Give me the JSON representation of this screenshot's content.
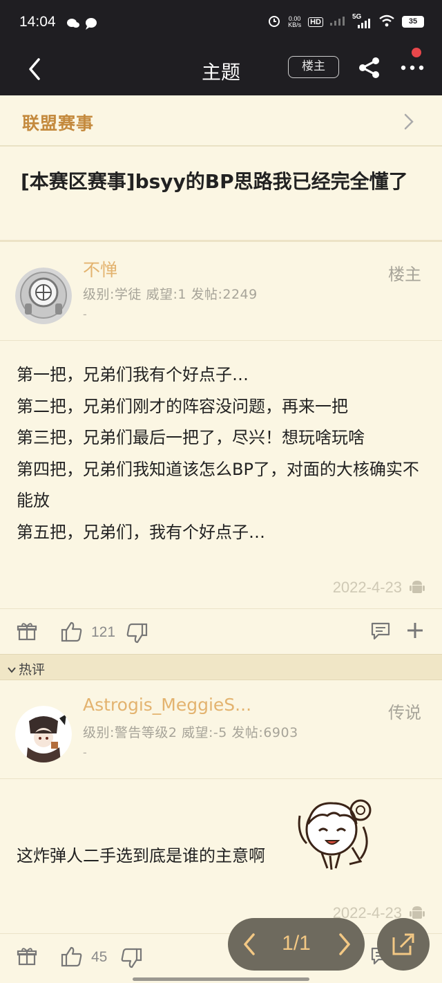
{
  "status_bar": {
    "time": "14:04",
    "net_speed_value": "0.00",
    "net_speed_unit": "KB/s",
    "hd": "HD",
    "network": "5G",
    "battery": "35"
  },
  "nav": {
    "title": "主题",
    "louzhu_button": "楼主"
  },
  "category": {
    "label": "联盟赛事"
  },
  "thread": {
    "title": "[本赛区赛事]bsyy的BP思路我已经完全懂了"
  },
  "main_post": {
    "username": "不惮",
    "meta": "级别:学徒 威望:1 发帖:2249",
    "dash": "-",
    "role": "楼主",
    "lines": [
      "第一把，兄弟们我有个好点子…",
      "第二把，兄弟们刚才的阵容没问题，再来一把",
      "第三把，兄弟们最后一把了，尽兴！想玩啥玩啥",
      "第四把，兄弟们我知道该怎么BP了，对面的大核确实不能放",
      "第五把，兄弟们，我有个好点子…"
    ],
    "date": "2022-4-23",
    "likes": "121"
  },
  "hot_section": {
    "label": "热评"
  },
  "reply": {
    "username": "Astrogis_MeggieS...",
    "meta": "级别:警告等级2 威望:-5 发帖:6903",
    "dash": "-",
    "role": "传说",
    "text": "这炸弹人二手选到底是谁的主意啊",
    "date": "2022-4-23",
    "likes": "45"
  },
  "pager": {
    "label": "1/1"
  },
  "colors": {
    "background": "#fbf6e3",
    "header": "#1f1e22",
    "accent": "#c48a3e",
    "username": "#e3b36f"
  }
}
